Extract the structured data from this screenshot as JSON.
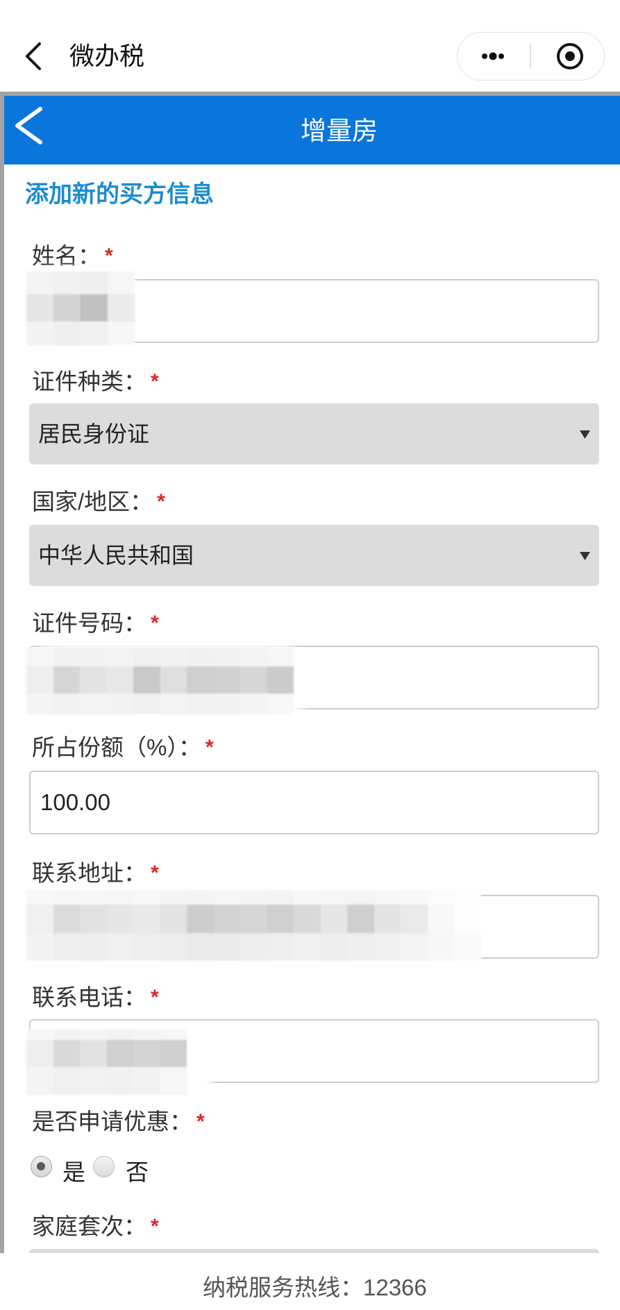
{
  "miniprogram_bar": {
    "title": "微办税",
    "icons": {
      "back": "chevron-left-icon",
      "more": "more-dots-icon",
      "close": "target-circle-icon"
    }
  },
  "header": {
    "title": "增量房",
    "back_icon": "chevron-left-icon"
  },
  "section_title": "添加新的买方信息",
  "required_mark": "*",
  "form": {
    "name": {
      "label": "姓名："
    },
    "id_type": {
      "label": "证件种类：",
      "selected": "居民身份证",
      "icon": "dropdown-arrow-icon"
    },
    "country": {
      "label": "国家/地区：",
      "selected": "中华人民共和国",
      "icon": "dropdown-arrow-icon"
    },
    "id_number": {
      "label": "证件号码："
    },
    "share_percent": {
      "label": "所占份额（%）：",
      "value": "100.00"
    },
    "address": {
      "label": "联系地址："
    },
    "phone": {
      "label": "联系电话："
    },
    "apply_discount": {
      "label": "是否申请优惠：",
      "options": [
        {
          "label": "是",
          "checked": true
        },
        {
          "label": "否",
          "checked": false
        }
      ]
    },
    "household_count": {
      "label": "家庭套次："
    }
  },
  "footer": {
    "hotline": "纳税服务热线：12366"
  },
  "colors": {
    "header_bg": "#0a76dc",
    "section_title": "#1b8cd1",
    "required": "#e02424",
    "select_bg": "#dcdcdc",
    "frame_border": "#a3a3a3"
  }
}
